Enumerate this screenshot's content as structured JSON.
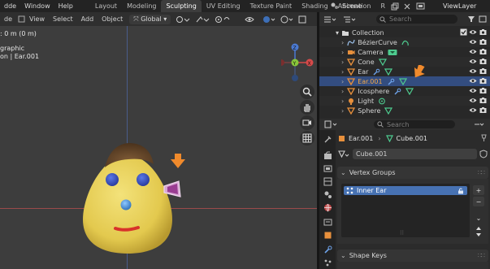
{
  "topbar": {
    "menus": [
      "dde",
      "Window",
      "Help"
    ],
    "workspaces": [
      "Layout",
      "Modeling",
      "Sculpting",
      "UV Editing",
      "Texture Paint",
      "Shading",
      "Animation",
      "R"
    ],
    "active_workspace": "Sculpting",
    "scene_label": "Scene",
    "viewlayer_label": "ViewLayer"
  },
  "viewport": {
    "menus": [
      "de",
      "View",
      "Select",
      "Add",
      "Object"
    ],
    "orientation": "Global",
    "overlay_line1": ": 0 m (0 m)",
    "overlay_line2": "graphic",
    "overlay_line3": "on | Ear.001",
    "gizmo": {
      "x": "X",
      "y": "Y",
      "z": "Z"
    }
  },
  "outliner": {
    "search_placeholder": "Search",
    "collection": "Collection",
    "items": [
      {
        "name": "BézierCurve",
        "type": "curve"
      },
      {
        "name": "Camera",
        "type": "camera"
      },
      {
        "name": "Cone",
        "type": "mesh"
      },
      {
        "name": "Ear",
        "type": "mesh"
      },
      {
        "name": "Ear.001",
        "type": "mesh",
        "selected": true
      },
      {
        "name": "Icosphere",
        "type": "mesh"
      },
      {
        "name": "Light",
        "type": "light"
      },
      {
        "name": "Sphere",
        "type": "mesh"
      }
    ]
  },
  "properties": {
    "search_placeholder": "Search",
    "breadcrumb_object": "Ear.001",
    "breadcrumb_mesh": "Cube.001",
    "mesh_datablock": "Cube.001",
    "vertex_groups_title": "Vertex Groups",
    "vertex_group_item": "Inner Ear",
    "shape_keys_title": "Shape Keys"
  },
  "colors": {
    "accent_blue": "#4772b3",
    "selection_row": "#334d80",
    "orange_arrow": "#f08a2c",
    "mesh_icon": "#e8903c",
    "data_icon": "#4ecb8f"
  }
}
